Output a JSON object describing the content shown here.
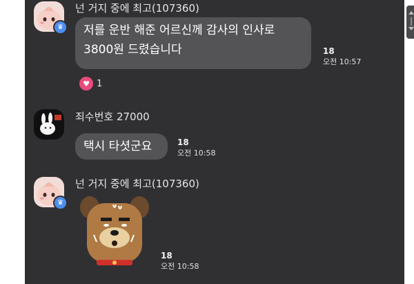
{
  "messages": [
    {
      "sender": "넌 거지 중에 최고(107360)",
      "avatar_icon": "apeach-avatar-icon",
      "badge_icon": "crown-icon",
      "lines": [
        "저를 운반 해준 어르신께 감사의 인사로",
        "3800원 드렸습니다"
      ],
      "unread": "18",
      "time": "오전 10:57",
      "reaction": {
        "icon": "heart-icon",
        "count": "1"
      }
    },
    {
      "sender": "죄수번호 27000",
      "avatar_icon": "rabbit-avatar-icon",
      "lines": [
        "택시 타셧군요"
      ],
      "unread": "18",
      "time": "오전 10:58"
    },
    {
      "sender": "넌 거지 중에 최고(107360)",
      "avatar_icon": "apeach-avatar-icon",
      "badge_icon": "crown-icon",
      "emoticon": "frodo-dog-sweating-emoticon",
      "unread": "18",
      "time": "오전 10:58"
    }
  ],
  "colors": {
    "chat_background": "#303033",
    "bubble": "#545457",
    "heart": "#e94a7c",
    "badge": "#4d8ef0"
  }
}
